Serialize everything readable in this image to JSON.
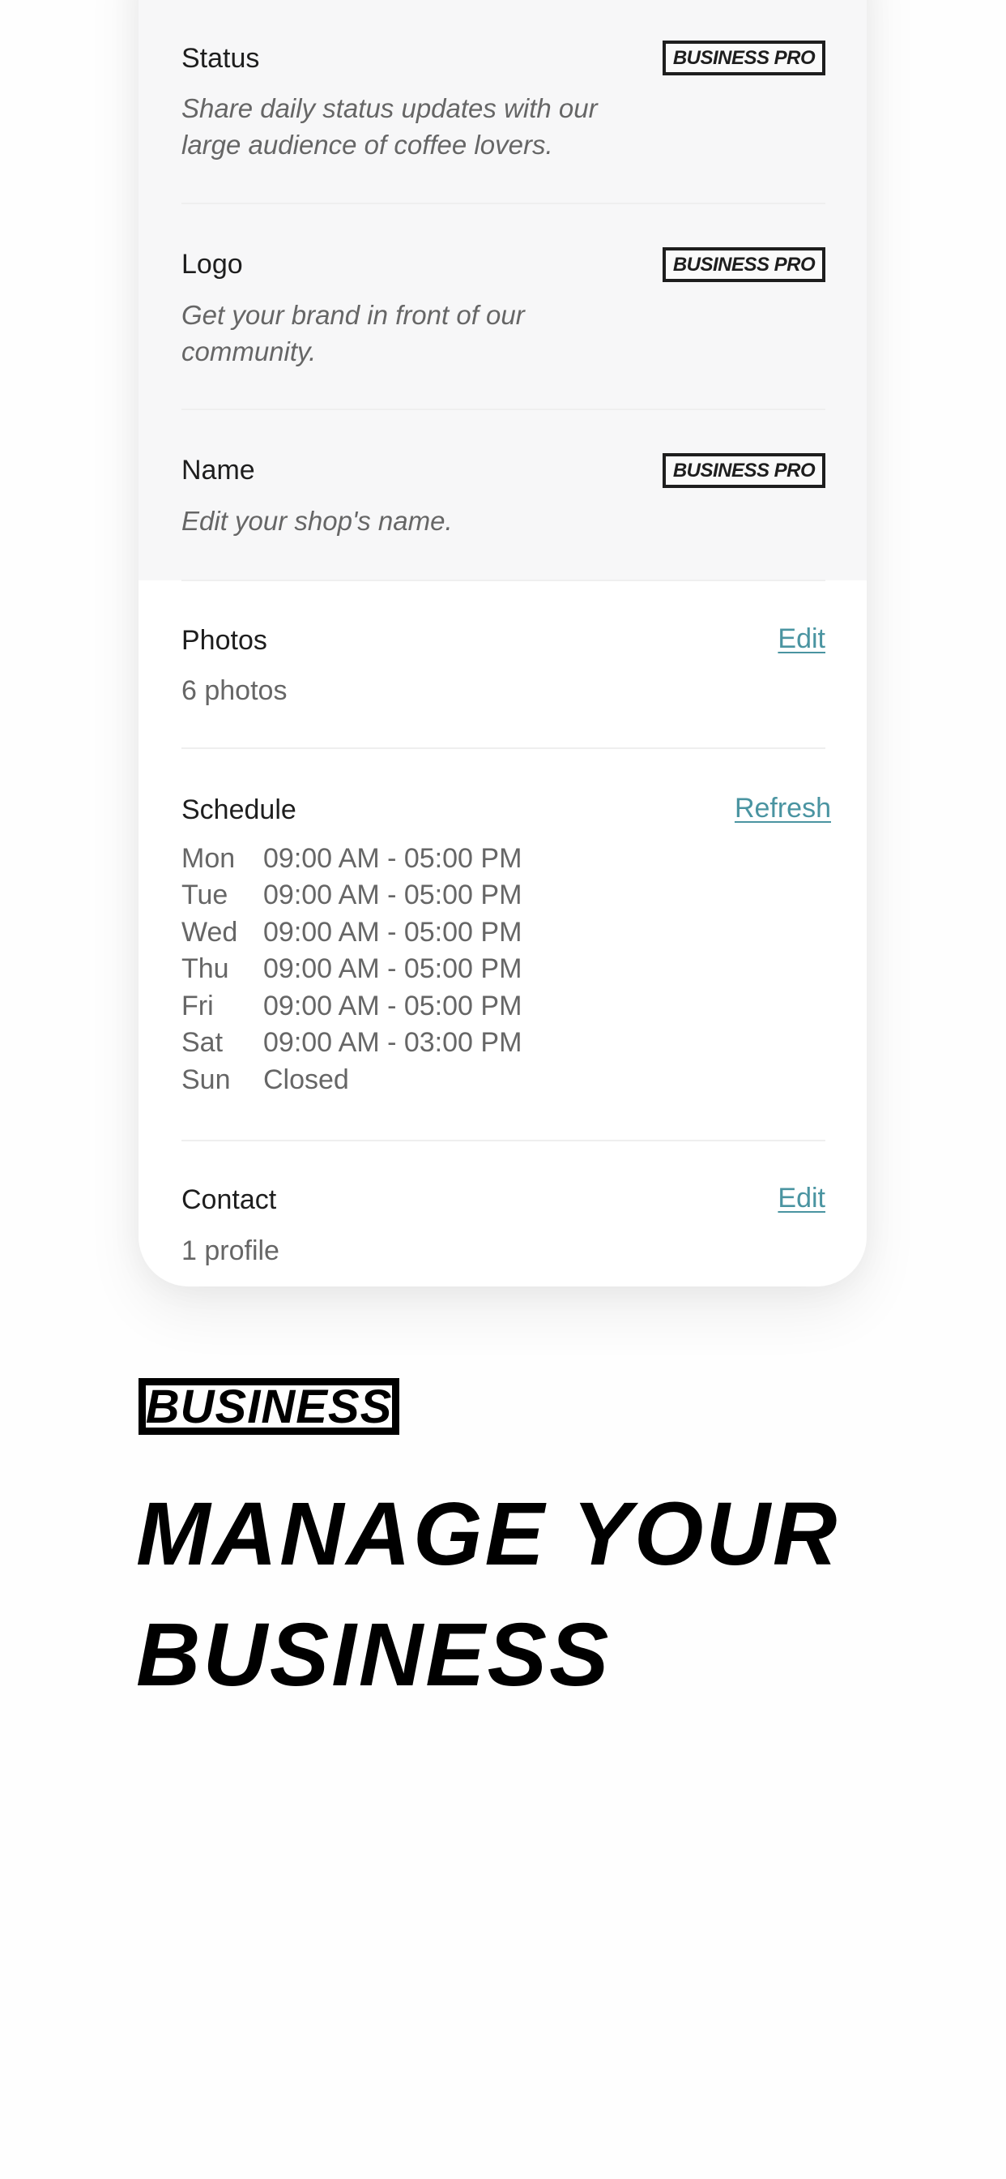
{
  "pro_features": [
    {
      "title": "Status",
      "description_lines": [
        "Share daily status updates with our",
        "large audience of coffee lovers."
      ],
      "badge": "BUSINESS PRO"
    },
    {
      "title": "Logo",
      "description_lines": [
        "Get your brand in front of our",
        "community."
      ],
      "badge": "BUSINESS PRO"
    },
    {
      "title": "Name",
      "description_lines": [
        "Edit your shop's name."
      ],
      "badge": "BUSINESS PRO"
    }
  ],
  "photos": {
    "title": "Photos",
    "action": "Edit",
    "summary": "6 photos"
  },
  "schedule": {
    "title": "Schedule",
    "action": "Refresh",
    "rows": [
      {
        "day": "Mon",
        "hours": "09:00 AM - 05:00 PM"
      },
      {
        "day": "Tue",
        "hours": "09:00 AM - 05:00 PM"
      },
      {
        "day": "Wed",
        "hours": "09:00 AM - 05:00 PM"
      },
      {
        "day": "Thu",
        "hours": "09:00 AM - 05:00 PM"
      },
      {
        "day": "Fri",
        "hours": "09:00 AM - 05:00 PM"
      },
      {
        "day": "Sat",
        "hours": "09:00 AM - 03:00 PM"
      },
      {
        "day": "Sun",
        "hours": "Closed"
      }
    ]
  },
  "contact": {
    "title": "Contact",
    "action": "Edit",
    "summary": "1 profile"
  },
  "hero": {
    "badge": "BUSINESS",
    "headline_lines": [
      "MANAGE YOUR",
      "BUSINESS"
    ]
  },
  "colors": {
    "link": "#4a94a1",
    "pro_section_bg": "#f7f7f8",
    "text": "#1e1e1e",
    "muted": "#666666"
  }
}
